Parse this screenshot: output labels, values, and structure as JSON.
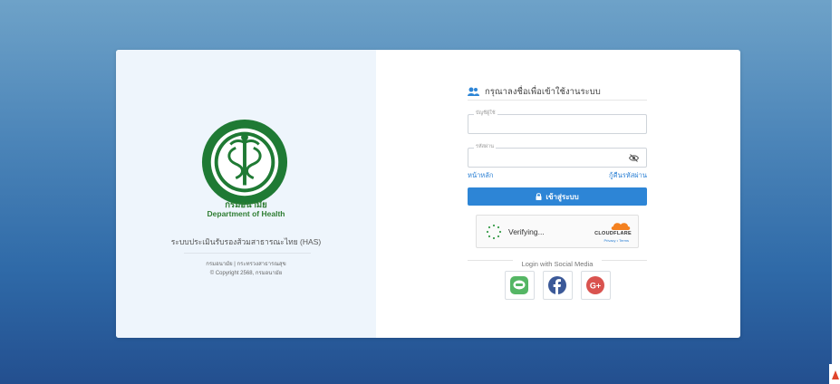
{
  "left_panel": {
    "org_name_th": "กรมอนามัย",
    "org_name_en": "Department of Health",
    "system_name": "ระบบประเมินรับรองส้วมสาธารณะไทย (HAS)",
    "footer_links": "กรมอนามัย | กระทรวงสาธารณสุข",
    "copyright": "© Copyright 2568, กรมอนามัย"
  },
  "login_form": {
    "title": "กรุณาลงชื่อเพื่อเข้าใช้งานระบบ",
    "username_label": "บัญชีผู้ใช้",
    "username_value": "",
    "password_label": "รหัสผ่าน",
    "password_value": "",
    "home_link": "หน้าหลัก",
    "forgot_link": "กู้คืนรหัสผ่าน",
    "login_button": "เข้าสู่ระบบ"
  },
  "captcha": {
    "status": "Verifying...",
    "provider": "CLOUDFLARE",
    "links": "Privacy • Terms"
  },
  "social": {
    "header": "Login with Social Media",
    "buttons": [
      "line-icon",
      "facebook-icon",
      "google-plus-icon"
    ]
  },
  "colors": {
    "accent": "#2d85d6",
    "brand_green": "#2e7d32",
    "line_green": "#55b665",
    "facebook_blue": "#3b5998",
    "google_red": "#d9534f",
    "cloudflare_orange": "#f48120"
  }
}
